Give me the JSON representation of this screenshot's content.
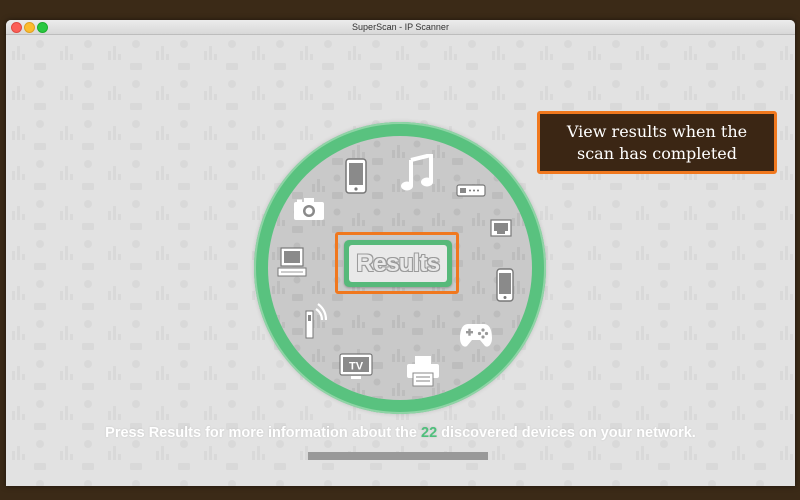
{
  "window": {
    "title": "SuperScan - IP Scanner"
  },
  "results_button": {
    "label": "Results"
  },
  "callout": {
    "text": "View results when the scan has completed"
  },
  "status": {
    "prefix": "Press Results for more information about the",
    "count": "22",
    "suffix": "discovered devices on your network."
  },
  "progress": {
    "value": 1.0
  },
  "devices": [
    {
      "icon": "tablet-icon"
    },
    {
      "icon": "music-note-icon"
    },
    {
      "icon": "router-icon"
    },
    {
      "icon": "network-port-icon"
    },
    {
      "icon": "smartphone-icon"
    },
    {
      "icon": "game-controller-icon"
    },
    {
      "icon": "printer-icon"
    },
    {
      "icon": "tv-icon",
      "label": "TV"
    },
    {
      "icon": "wireless-access-point-icon"
    },
    {
      "icon": "desktop-computer-icon"
    },
    {
      "icon": "camera-icon"
    }
  ],
  "colors": {
    "accent_green": "#57b97a",
    "highlight_orange": "#f0781e",
    "callout_bg": "#3b2614",
    "desktop_bg": "#3b2a17"
  }
}
